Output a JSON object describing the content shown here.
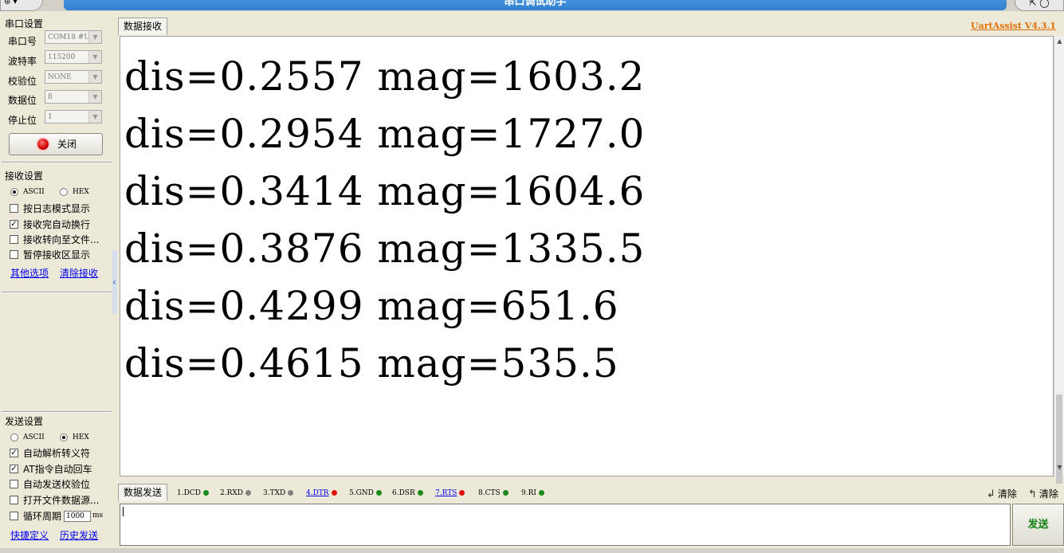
{
  "window": {
    "title": "串口调试助手",
    "menu_glyph": "⊛ ▾",
    "controls_glyph": "⇱ ◯"
  },
  "serial_settings": {
    "title": "串口设置",
    "port": {
      "label": "串口号",
      "value": "COM18 #US"
    },
    "baud": {
      "label": "波特率",
      "value": "115200"
    },
    "parity": {
      "label": "校验位",
      "value": "NONE"
    },
    "databits": {
      "label": "数据位",
      "value": "8"
    },
    "stopbits": {
      "label": "停止位",
      "value": "1"
    },
    "close_button": "关闭"
  },
  "receive_settings": {
    "title": "接收设置",
    "ascii_label": "ASCII",
    "hex_label": "HEX",
    "mode_selected": "ASCII",
    "options": [
      {
        "label": "按日志模式显示",
        "checked": false
      },
      {
        "label": "接收完自动换行",
        "checked": true
      },
      {
        "label": "接收转向至文件...",
        "checked": false
      },
      {
        "label": "暂停接收区显示",
        "checked": false
      }
    ],
    "link_more": "其他选项",
    "link_clear": "清除接收"
  },
  "send_settings": {
    "title": "发送设置",
    "ascii_label": "ASCII",
    "hex_label": "HEX",
    "mode_selected": "HEX",
    "options": [
      {
        "label": "自动解析转义符",
        "checked": true
      },
      {
        "label": "AT指令自动回车",
        "checked": true
      },
      {
        "label": "自动发送校验位",
        "checked": false
      },
      {
        "label": "打开文件数据源...",
        "checked": false
      }
    ],
    "loop_label": "循环周期",
    "loop_value": "1000",
    "loop_unit": "ms",
    "link_shortcut": "快捷定义",
    "link_history": "历史发送"
  },
  "receive": {
    "tab_label": "数据接收",
    "version": "UartAssist V4.3.1",
    "lines": [
      "dis=0.2557 mag=1603.2",
      "dis=0.2954 mag=1727.0",
      "dis=0.3414 mag=1604.6",
      "dis=0.3876 mag=1335.5",
      "dis=0.4299 mag=651.6",
      "dis=0.4615 mag=535.5"
    ]
  },
  "send": {
    "tab_label": "数据发送",
    "signals": [
      {
        "label": "1.DCD",
        "color": "#1a8a1a",
        "link": false
      },
      {
        "label": "2.RXD",
        "color": "#808080",
        "link": false
      },
      {
        "label": "3.TXD",
        "color": "#808080",
        "link": false
      },
      {
        "label": "4.DTR",
        "color": "#e01010",
        "link": true
      },
      {
        "label": "5.GND",
        "color": "#1a8a1a",
        "link": false
      },
      {
        "label": "6.DSR",
        "color": "#1a8a1a",
        "link": false
      },
      {
        "label": "7.RTS",
        "color": "#e01010",
        "link": true
      },
      {
        "label": "8.CTS",
        "color": "#1a8a1a",
        "link": false
      },
      {
        "label": "9.RI",
        "color": "#1a8a1a",
        "link": false
      }
    ],
    "clear_label": "清除",
    "clear_all_label": "清除",
    "send_button": "发送",
    "input_value": ""
  }
}
